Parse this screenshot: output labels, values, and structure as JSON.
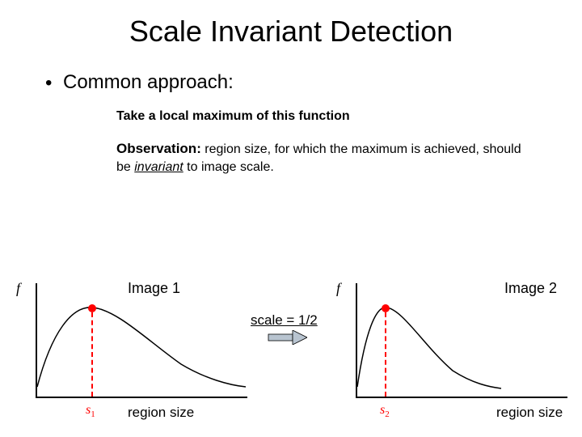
{
  "title": "Scale Invariant Detection",
  "bullet": "Common approach:",
  "sub1": "Take a local maximum of this function",
  "obs_label": "Observation:",
  "obs_text_a": " region size, for which the maximum is achieved, should be ",
  "obs_italic": "invariant",
  "obs_text_b": " to image scale.",
  "axis_y_label": "f",
  "chart1": {
    "title": "Image 1",
    "xlabel": "region size",
    "peak_label": "s",
    "peak_sub": "1"
  },
  "chart2": {
    "title": "Image 2",
    "xlabel": "region size",
    "peak_label": "s",
    "peak_sub": "2"
  },
  "scale_text": "scale = 1/2",
  "chart_data": [
    {
      "type": "line",
      "title": "Image 1",
      "xlabel": "region size",
      "ylabel": "f",
      "x": [
        0,
        20,
        40,
        70,
        90,
        120,
        160,
        200,
        240,
        260
      ],
      "y": [
        15,
        70,
        98,
        108,
        104,
        82,
        50,
        30,
        18,
        14
      ],
      "peak_x_label": "s1",
      "peak_x": 70,
      "peak_y": 108,
      "xlim": [
        0,
        260
      ],
      "ylim": [
        0,
        140
      ]
    },
    {
      "type": "line",
      "title": "Image 2",
      "xlabel": "region size",
      "ylabel": "f",
      "x": [
        0,
        12,
        22,
        36,
        48,
        64,
        90,
        120,
        150,
        170
      ],
      "y": [
        15,
        70,
        98,
        108,
        100,
        72,
        40,
        22,
        14,
        12
      ],
      "peak_x_label": "s2",
      "peak_x": 36,
      "peak_y": 108,
      "xlim": [
        0,
        260
      ],
      "ylim": [
        0,
        140
      ]
    }
  ]
}
